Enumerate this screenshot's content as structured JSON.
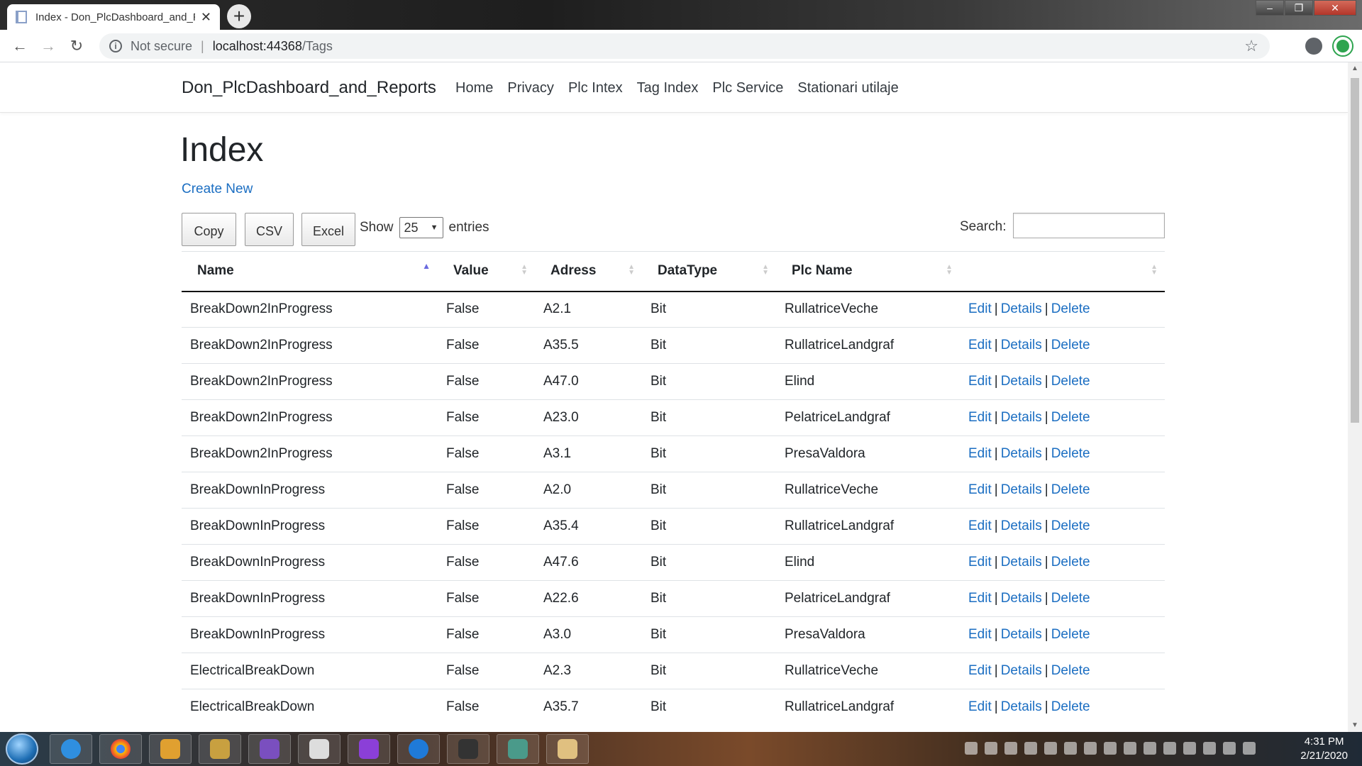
{
  "browser": {
    "tab_title": "Index - Don_PlcDashboard_and_R",
    "tab_close": "✕",
    "new_tab": "+",
    "security_label": "Not secure",
    "url_host": "localhost:44368",
    "url_path": "/Tags",
    "win_minimize": "–",
    "win_maximize": "❐",
    "win_close": "✕"
  },
  "navbar": {
    "brand": "Don_PlcDashboard_and_Reports",
    "links": [
      "Home",
      "Privacy",
      "Plc Intex",
      "Tag Index",
      "Plc Service",
      "Stationari utilaje"
    ]
  },
  "page": {
    "title": "Index",
    "create_new": "Create New"
  },
  "controls": {
    "buttons": [
      "Copy",
      "CSV",
      "Excel"
    ],
    "show_label": "Show",
    "page_size": "25",
    "entries_label": "entries",
    "search_label": "Search:",
    "search_value": ""
  },
  "table": {
    "headers": [
      "Name",
      "Value",
      "Adress",
      "DataType",
      "Plc Name",
      ""
    ],
    "link_edit": "Edit",
    "link_details": "Details",
    "link_delete": "Delete",
    "pipe": "|",
    "rows": [
      [
        "BreakDown2InProgress",
        "False",
        "A2.1",
        "Bit",
        "RullatriceVeche"
      ],
      [
        "BreakDown2InProgress",
        "False",
        "A35.5",
        "Bit",
        "RullatriceLandgraf"
      ],
      [
        "BreakDown2InProgress",
        "False",
        "A47.0",
        "Bit",
        "Elind"
      ],
      [
        "BreakDown2InProgress",
        "False",
        "A23.0",
        "Bit",
        "PelatriceLandgraf"
      ],
      [
        "BreakDown2InProgress",
        "False",
        "A3.1",
        "Bit",
        "PresaValdora"
      ],
      [
        "BreakDownInProgress",
        "False",
        "A2.0",
        "Bit",
        "RullatriceVeche"
      ],
      [
        "BreakDownInProgress",
        "False",
        "A35.4",
        "Bit",
        "RullatriceLandgraf"
      ],
      [
        "BreakDownInProgress",
        "False",
        "A47.6",
        "Bit",
        "Elind"
      ],
      [
        "BreakDownInProgress",
        "False",
        "A22.6",
        "Bit",
        "PelatriceLandgraf"
      ],
      [
        "BreakDownInProgress",
        "False",
        "A3.0",
        "Bit",
        "PresaValdora"
      ],
      [
        "ElectricalBreakDown",
        "False",
        "A2.3",
        "Bit",
        "RullatriceVeche"
      ],
      [
        "ElectricalBreakDown",
        "False",
        "A35.7",
        "Bit",
        "RullatriceLandgraf"
      ]
    ]
  },
  "taskbar": {
    "time": "4:31 PM",
    "date": "2/21/2020"
  },
  "colors": {
    "link": "#1b6ec2",
    "sort_active": "#6a6adf"
  }
}
